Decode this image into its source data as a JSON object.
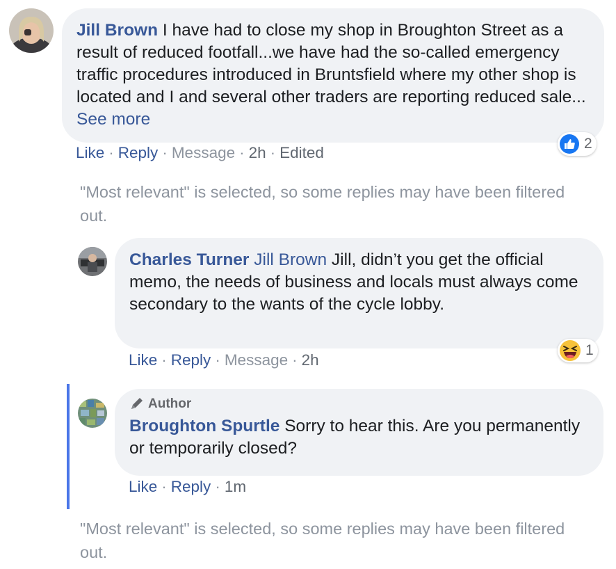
{
  "comments": [
    {
      "author": "Jill Brown",
      "text": " I have had to close my shop in Broughton Street as a result of reduced footfall...we have had the so-called emergency traffic procedures introduced in Bruntsfield where my other shop is located and I and several other traders are reporting reduced sale...",
      "see_more": " See more",
      "reaction": {
        "icon": "like",
        "count": "2"
      },
      "actions": {
        "like": "Like",
        "reply": "Reply",
        "message": "Message",
        "time": "2h",
        "edited": "Edited"
      }
    },
    {
      "author": "Charles Turner",
      "mention": "Jill Brown",
      "text": " Jill, didn’t you get the official memo, the needs of business and locals must always come secondary to the wants of the cycle lobby.",
      "reaction": {
        "icon": "haha",
        "count": "1"
      },
      "actions": {
        "like": "Like",
        "reply": "Reply",
        "message": "Message",
        "time": "2h"
      }
    },
    {
      "badge": "Author",
      "author": "Broughton Spurtle",
      "text": " Sorry to hear this. Are you permanently or temporarily closed?",
      "actions": {
        "like": "Like",
        "reply": "Reply",
        "time": "1m"
      }
    }
  ],
  "notices": {
    "first": "\"Most relevant\" is selected, so some replies may have been filtered out.",
    "second": "\"Most relevant\" is selected, so some replies may have been filtered out."
  },
  "actions_separator": "·",
  "colors": {
    "link": "#385898",
    "bubble": "#f0f2f5",
    "thread_bar": "#4a76e8",
    "like_reaction": "#1877f2",
    "haha_reaction": "#f7c23a"
  }
}
